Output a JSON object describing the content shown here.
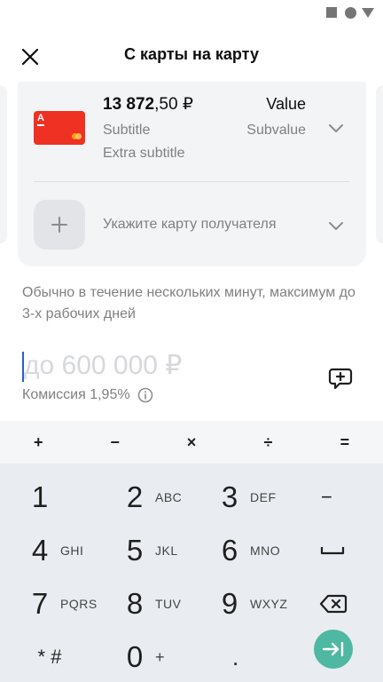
{
  "status_bar": {
    "icons": [
      "square-icon",
      "circle-icon",
      "triangle-icon"
    ]
  },
  "header": {
    "title": "С карты на карту",
    "close_icon": "close-icon"
  },
  "source_card": {
    "balance_whole": "13 872",
    "balance_fraction": ",50 ₽",
    "subtitle": "Subtitle",
    "extra_subtitle": "Extra subtitle",
    "value": "Value",
    "subvalue": "Subvalue",
    "bank_logo": "А",
    "card_color": "#ef3124"
  },
  "recipient": {
    "label": "Укажите карту получателя",
    "add_icon": "plus-icon"
  },
  "info_text": "Обычно в течение нескольких минут, максимум до 3-х рабочих дней",
  "amount": {
    "placeholder": "до 600 000 ₽",
    "value": ""
  },
  "commission": {
    "label": "Комиссия 1,95%",
    "icon": "info-icon"
  },
  "comment_icon": "comment-add-icon",
  "keyboard": {
    "ops": [
      "+",
      "−",
      "×",
      "÷",
      "="
    ],
    "keys": [
      {
        "num": "1",
        "letters": ""
      },
      {
        "num": "2",
        "letters": "ABC"
      },
      {
        "num": "3",
        "letters": "DEF"
      },
      {
        "num": "4",
        "letters": "GHI"
      },
      {
        "num": "5",
        "letters": "JKL"
      },
      {
        "num": "6",
        "letters": "MNO"
      },
      {
        "num": "7",
        "letters": "PQRS"
      },
      {
        "num": "8",
        "letters": "TUV"
      },
      {
        "num": "9",
        "letters": "WXYZ"
      },
      {
        "num": "* #",
        "letters": ""
      },
      {
        "num": "0",
        "letters": "+"
      },
      {
        "num": ".",
        "letters": ""
      }
    ],
    "minus_key": "−",
    "space_icon": "space-icon",
    "backspace_icon": "backspace-icon",
    "enter_icon": "enter-icon",
    "accent": "#4fb8a3"
  }
}
